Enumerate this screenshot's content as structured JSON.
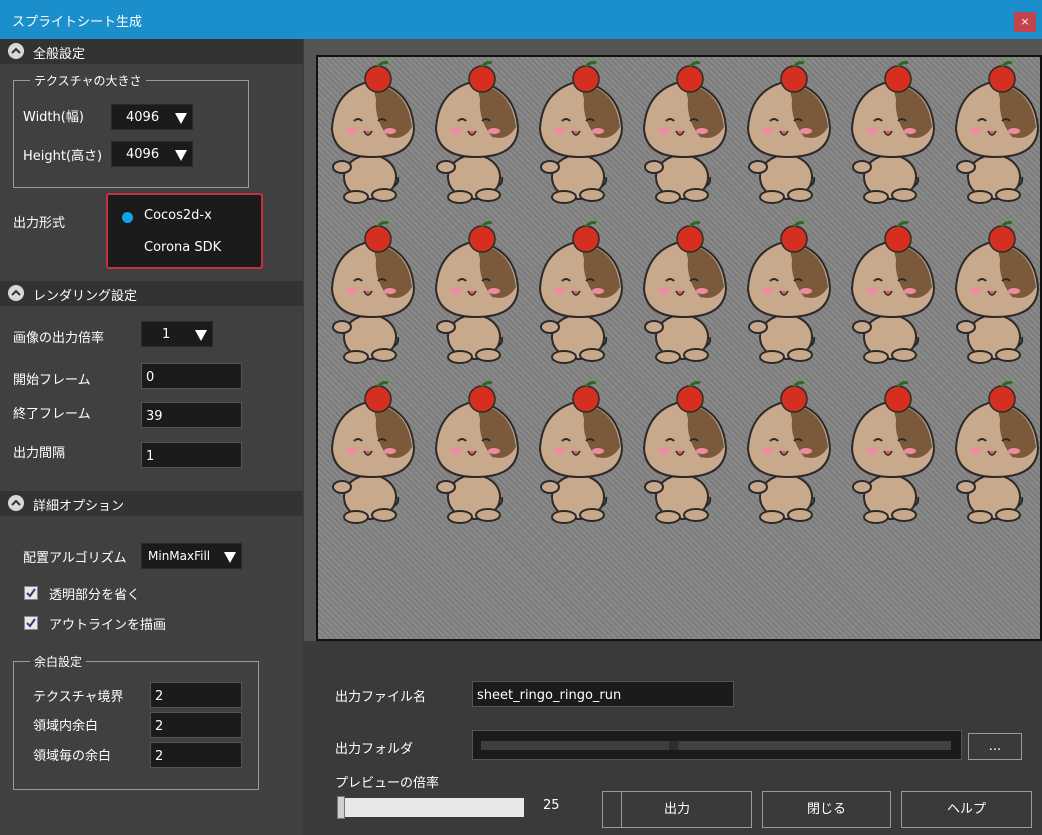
{
  "window": {
    "title": "スプライトシート生成",
    "close_glyph": "×"
  },
  "general": {
    "header": "全般設定",
    "texture_group": "テクスチャの大きさ",
    "width_label": "Width(幅)",
    "width_value": "4096",
    "height_label": "Height(高さ)",
    "height_value": "4096",
    "format_label": "出力形式",
    "format_options": [
      "Cocos2d-x",
      "Corona SDK"
    ],
    "format_selected": "Cocos2d-x"
  },
  "rendering": {
    "header": "レンダリング設定",
    "scale_label": "画像の出力倍率",
    "scale_value": "1",
    "start_label": "開始フレーム",
    "start_value": "0",
    "end_label": "終了フレーム",
    "end_value": "39",
    "interval_label": "出力間隔",
    "interval_value": "1"
  },
  "detail": {
    "header": "詳細オプション",
    "algo_label": "配置アルゴリズム",
    "algo_value": "MinMaxFill",
    "trim_label": "透明部分を省く",
    "trim_checked": true,
    "outline_label": "アウトラインを描画",
    "outline_checked": true,
    "margin_group": "余白設定",
    "border_label": "テクスチャ境界",
    "border_value": "2",
    "inner_label": "領域内余白",
    "inner_value": "2",
    "each_label": "領域毎の余白",
    "each_value": "2"
  },
  "preview": {
    "frames": 21,
    "colors": {
      "body": "#c9a98c",
      "patch": "#7a5a3a",
      "apple": "#d62f20",
      "leaf": "#2d6a1e"
    }
  },
  "output": {
    "file_label": "出力ファイル名",
    "file_value": "sheet_ringo_ringo_run",
    "folder_label": "出力フォルダ",
    "folder_browse": "...",
    "zoom_label": "プレビューの倍率",
    "zoom_value": "25",
    "btn_output": "出力",
    "btn_close": "閉じる",
    "btn_help": "ヘルプ"
  },
  "colors": {
    "titlebar": "#1a8fcb",
    "close": "#c4444b",
    "accent": "#12a4ea",
    "highlight": "#c9303a"
  }
}
